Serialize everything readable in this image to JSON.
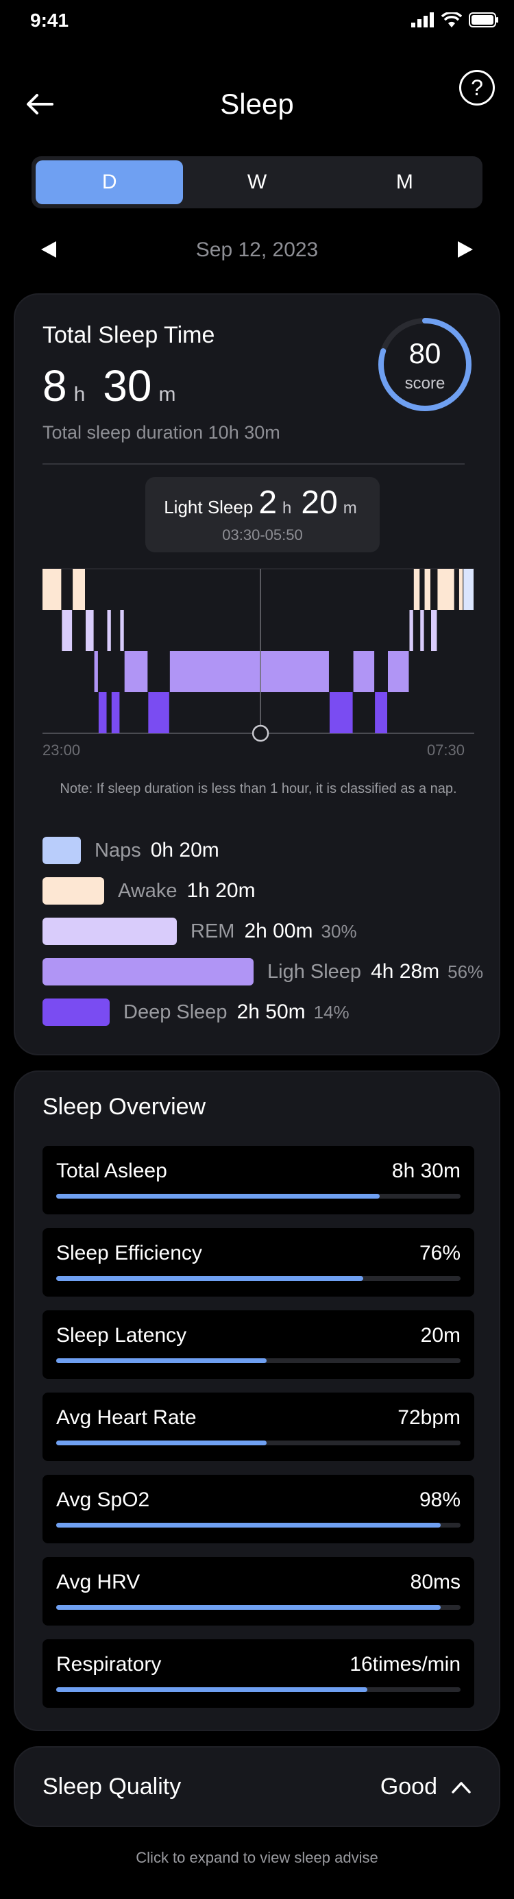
{
  "status": {
    "time": "9:41"
  },
  "nav": {
    "title": "Sleep",
    "help": "?"
  },
  "tabs": [
    {
      "label": "D",
      "active": true
    },
    {
      "label": "W",
      "active": false
    },
    {
      "label": "M",
      "active": false
    }
  ],
  "date": "Sep 12, 2023",
  "summary": {
    "title": "Total Sleep Time",
    "hours": "8",
    "hours_unit": "h",
    "minutes": "30",
    "minutes_unit": "m",
    "subtitle": "Total sleep duration 10h 30m",
    "score": "80",
    "score_label": "score",
    "score_fraction": 0.8
  },
  "tooltip": {
    "label": "Light Sleep",
    "hours": "2",
    "hours_unit": "h",
    "minutes": "20",
    "minutes_unit": "m",
    "range": "03:30-05:50"
  },
  "chart_data": {
    "type": "bar",
    "x_start": "23:00",
    "x_end": "07:30",
    "stages": [
      "Awake",
      "REM",
      "Light Sleep",
      "Deep Sleep"
    ],
    "segments": [
      {
        "stage": "Awake",
        "start": 0.0,
        "end": 0.045
      },
      {
        "stage": "REM",
        "start": 0.045,
        "end": 0.07
      },
      {
        "stage": "Awake",
        "start": 0.07,
        "end": 0.1
      },
      {
        "stage": "REM",
        "start": 0.1,
        "end": 0.12
      },
      {
        "stage": "Light Sleep",
        "start": 0.12,
        "end": 0.13
      },
      {
        "stage": "Deep Sleep",
        "start": 0.13,
        "end": 0.15
      },
      {
        "stage": "REM",
        "start": 0.15,
        "end": 0.16
      },
      {
        "stage": "Deep Sleep",
        "start": 0.16,
        "end": 0.18
      },
      {
        "stage": "REM",
        "start": 0.18,
        "end": 0.19
      },
      {
        "stage": "Light Sleep",
        "start": 0.19,
        "end": 0.245
      },
      {
        "stage": "Deep Sleep",
        "start": 0.245,
        "end": 0.295
      },
      {
        "stage": "Light Sleep",
        "start": 0.295,
        "end": 0.665
      },
      {
        "stage": "Deep Sleep",
        "start": 0.665,
        "end": 0.72
      },
      {
        "stage": "Light Sleep",
        "start": 0.72,
        "end": 0.77
      },
      {
        "stage": "Deep Sleep",
        "start": 0.77,
        "end": 0.8
      },
      {
        "stage": "Light Sleep",
        "start": 0.8,
        "end": 0.85
      },
      {
        "stage": "REM",
        "start": 0.85,
        "end": 0.86
      },
      {
        "stage": "Awake",
        "start": 0.86,
        "end": 0.875
      },
      {
        "stage": "REM",
        "start": 0.875,
        "end": 0.885
      },
      {
        "stage": "Awake",
        "start": 0.885,
        "end": 0.9
      },
      {
        "stage": "REM",
        "start": 0.9,
        "end": 0.915
      },
      {
        "stage": "Awake",
        "start": 0.915,
        "end": 0.955
      },
      {
        "stage": "Awake",
        "start": 0.965,
        "end": 0.975
      },
      {
        "stage": "Naps",
        "start": 0.975,
        "end": 1.0
      }
    ],
    "cursor": 0.505
  },
  "note": "Note: If sleep duration is less than 1 hour, it is classified as a nap.",
  "legend": [
    {
      "name": "Naps",
      "value": "0h 20m",
      "pct": "",
      "color": "#b9cdfb",
      "fraction": 0.04
    },
    {
      "name": "Awake",
      "value": "1h 20m",
      "pct": "",
      "color": "#fde7d3",
      "fraction": 0.13
    },
    {
      "name": "REM",
      "value": "2h 00m",
      "pct": "30%",
      "color": "#d9ccfb",
      "fraction": 0.3
    },
    {
      "name": "Ligh Sleep",
      "value": "4h 28m",
      "pct": "56%",
      "color": "#b095f5",
      "fraction": 0.56
    },
    {
      "name": "Deep Sleep",
      "value": "2h 50m",
      "pct": "14%",
      "color": "#7a4cf2",
      "fraction": 0.14
    }
  ],
  "overview": {
    "title": "Sleep Overview",
    "metrics": [
      {
        "name": "Total Asleep",
        "value": "8h 30m",
        "level": 0.8
      },
      {
        "name": "Sleep Efficiency",
        "value": "76%",
        "level": 0.76
      },
      {
        "name": "Sleep Latency",
        "value": "20m",
        "level": 0.52
      },
      {
        "name": "Avg Heart Rate",
        "value": "72bpm",
        "level": 0.52
      },
      {
        "name": "Avg SpO2",
        "value": "98%",
        "level": 0.95
      },
      {
        "name": "Avg HRV",
        "value": "80ms",
        "level": 0.95
      },
      {
        "name": "Respiratory",
        "value": "16times/min",
        "level": 0.77
      }
    ]
  },
  "quality": {
    "title": "Sleep Quality",
    "value": "Good"
  },
  "advise": "Click to expand to view sleep advise",
  "colors": {
    "accent": "#6fa0f2",
    "card": "#17181d"
  }
}
